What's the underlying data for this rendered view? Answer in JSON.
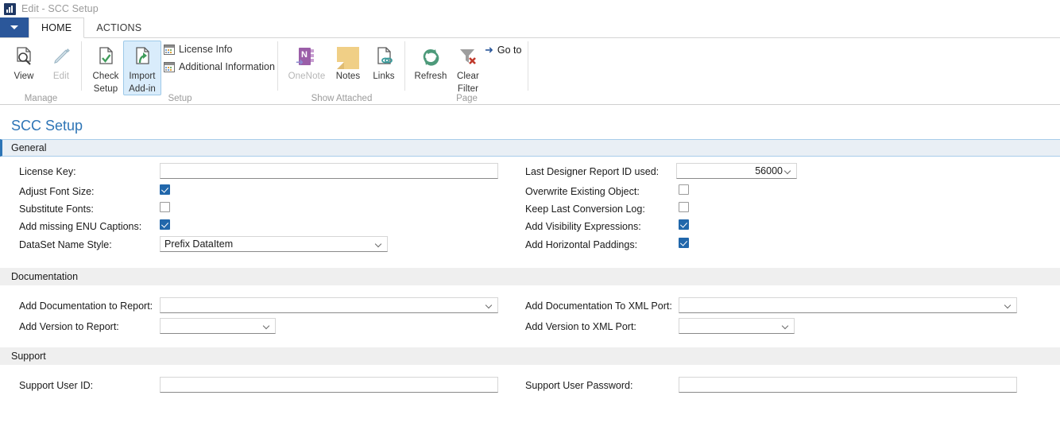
{
  "window": {
    "title": "Edit - SCC Setup",
    "app_icon": "bar-chart-icon"
  },
  "tabs": {
    "quick_access_label": "",
    "items": [
      {
        "label": "HOME",
        "active": true
      },
      {
        "label": "ACTIONS",
        "active": false
      }
    ]
  },
  "ribbon": {
    "groups": [
      {
        "name": "Manage",
        "label": "Manage",
        "buttons": [
          {
            "label_line1": "View",
            "label_line2": "",
            "icon": "page-search-icon",
            "disabled": false,
            "selected": false
          },
          {
            "label_line1": "Edit",
            "label_line2": "",
            "icon": "pencil-icon",
            "disabled": true,
            "selected": false
          }
        ]
      },
      {
        "name": "Setup",
        "label": "Setup",
        "buttons": [
          {
            "label_line1": "Check",
            "label_line2": "Setup",
            "icon": "page-check-icon",
            "disabled": false,
            "selected": false
          },
          {
            "label_line1": "Import",
            "label_line2": "Add-in",
            "icon": "page-import-icon",
            "disabled": false,
            "selected": true
          }
        ],
        "small_buttons": [
          {
            "label": "License Info",
            "icon": "table-grid-icon"
          },
          {
            "label": "Additional Information",
            "icon": "table-grid-icon"
          }
        ]
      },
      {
        "name": "Show Attached",
        "label": "Show Attached",
        "buttons": [
          {
            "label_line1": "OneNote",
            "label_line2": "",
            "icon": "onenote-icon",
            "disabled": true,
            "selected": false
          },
          {
            "label_line1": "Notes",
            "label_line2": "",
            "icon": "sticky-note-icon",
            "disabled": false,
            "selected": false
          },
          {
            "label_line1": "Links",
            "label_line2": "",
            "icon": "page-link-icon",
            "disabled": false,
            "selected": false
          }
        ]
      },
      {
        "name": "Page",
        "label": "Page",
        "buttons": [
          {
            "label_line1": "Refresh",
            "label_line2": "",
            "icon": "refresh-icon",
            "disabled": false,
            "selected": false
          },
          {
            "label_line1": "Clear",
            "label_line2": "Filter",
            "icon": "clear-filter-icon",
            "disabled": false,
            "selected": false
          }
        ],
        "small_buttons": [
          {
            "label": "Go to",
            "icon": "arrow-right-icon"
          }
        ]
      }
    ]
  },
  "page": {
    "title": "SCC Setup",
    "sections": [
      {
        "name": "general",
        "header": "General",
        "left_fields": [
          {
            "label": "License Key:",
            "type": "text",
            "value": ""
          },
          {
            "label": "Adjust Font Size:",
            "type": "checkbox",
            "checked": true
          },
          {
            "label": "Substitute Fonts:",
            "type": "checkbox",
            "checked": false
          },
          {
            "label": "Add missing ENU Captions:",
            "type": "checkbox",
            "checked": true
          },
          {
            "label": "DataSet Name Style:",
            "type": "dropdown",
            "value": "Prefix DataItem"
          }
        ],
        "right_fields": [
          {
            "label": "Last Designer Report ID used:",
            "type": "dropdown",
            "value": "56000",
            "align": "right"
          },
          {
            "label": "Overwrite Existing Object:",
            "type": "checkbox",
            "checked": false
          },
          {
            "label": "Keep Last Conversion Log:",
            "type": "checkbox",
            "checked": false
          },
          {
            "label": "Add Visibility Expressions:",
            "type": "checkbox",
            "checked": true
          },
          {
            "label": "Add Horizontal Paddings:",
            "type": "checkbox",
            "checked": true
          }
        ]
      },
      {
        "name": "documentation",
        "header": "Documentation",
        "left_fields": [
          {
            "label": "Add Documentation to Report:",
            "type": "dropdown",
            "value": ""
          },
          {
            "label": "Add Version to Report:",
            "type": "dropdown",
            "value": ""
          }
        ],
        "right_fields": [
          {
            "label": "Add Documentation To XML Port:",
            "type": "dropdown",
            "value": ""
          },
          {
            "label": "Add Version to XML Port:",
            "type": "dropdown",
            "value": ""
          }
        ]
      },
      {
        "name": "support",
        "header": "Support",
        "left_fields": [
          {
            "label": "Support User ID:",
            "type": "text",
            "value": ""
          }
        ],
        "right_fields": [
          {
            "label": "Support User Password:",
            "type": "text",
            "value": ""
          }
        ]
      }
    ]
  },
  "colors": {
    "accent_blue": "#2b579a",
    "title_link": "#2e75b6",
    "checkbox_on": "#2167ab",
    "section_gray": "#efefef",
    "general_band": "#e9eff5"
  }
}
